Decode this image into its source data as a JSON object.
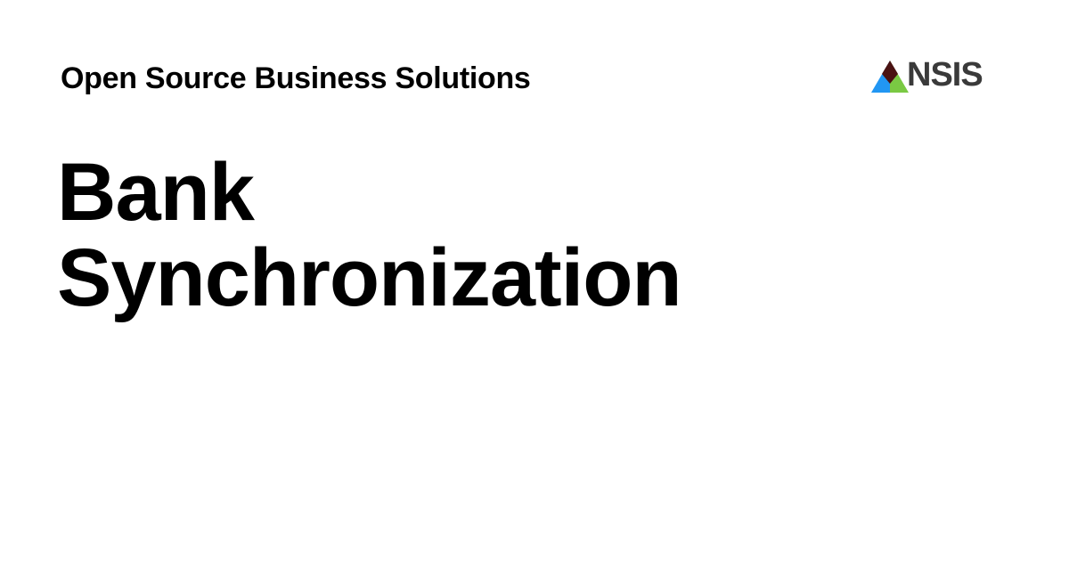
{
  "header": {
    "tagline": "Open Source Business Solutions",
    "logo_text": "NSIS",
    "logo_icon": "triangle-mark-icon"
  },
  "title": {
    "line1": "Bank",
    "line2": "Synchronization"
  },
  "colors": {
    "background": "#ffffff",
    "text": "#000000",
    "logo_text": "#3a3a3a",
    "logo_green": "#7ac943",
    "logo_blue": "#2196f3",
    "logo_dark": "#4a1212"
  }
}
